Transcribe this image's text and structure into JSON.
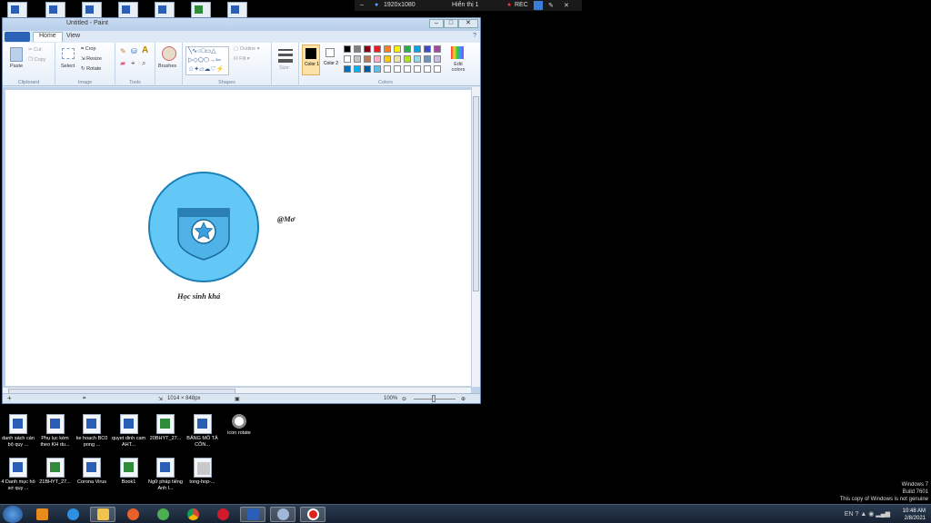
{
  "recorder": {
    "resolution": "1920x1080",
    "display": "Hiển thị 1",
    "rec_label": "REC"
  },
  "window": {
    "title": "Untitled - Paint"
  },
  "ribbon": {
    "tabs": [
      "Home",
      "View"
    ],
    "clipboard": {
      "paste": "Paste",
      "cut": "Cut",
      "copy": "Copy",
      "label": "Clipboard"
    },
    "image": {
      "select": "Select",
      "crop": "Crop",
      "resize": "Resize",
      "rotate": "Rotate",
      "label": "Image"
    },
    "tools": {
      "label": "Tools"
    },
    "brushes": "Brushes",
    "shapes": {
      "outline": "Outline",
      "fill": "Fill",
      "label": "Shapes"
    },
    "size": "Size",
    "color1": "Color 1",
    "color2": "Color 2",
    "edit_colors": "Edit colors",
    "colors_label": "Colors",
    "palette_row1": [
      "#000000",
      "#7f7f7f",
      "#880015",
      "#ed1c24",
      "#ff7f27",
      "#fff200",
      "#22b14c",
      "#00a2e8",
      "#3f48cc",
      "#a349a4"
    ],
    "palette_row2": [
      "#ffffff",
      "#c3c3c3",
      "#b97a57",
      "#ffaec9",
      "#ffc90e",
      "#efe4b0",
      "#b5e61d",
      "#99d9ea",
      "#7092be",
      "#c8bfe7"
    ],
    "palette_row3": [
      "#0070c0",
      "#00b0f0",
      "#005a9e",
      "#5bc0eb",
      "#ffffff",
      "#ffffff",
      "#ffffff",
      "#ffffff",
      "#ffffff",
      "#ffffff"
    ]
  },
  "canvas": {
    "watermark_text": "@Mơ",
    "caption": "Học sinh khá",
    "badge_outer": "#63c8f5",
    "badge_ring": "#1b80b8",
    "shield_fill": "#4fb3e8",
    "shield_band": "#2a7fb4",
    "star_fill": "#3aa0e0"
  },
  "status": {
    "dimensions": "1014 × 848px",
    "zoom": "100%"
  },
  "desktop_icons": [
    {
      "label": "danh sách cán bộ quy ...",
      "kind": "word"
    },
    {
      "label": "Phụ lục kèm theo KH du...",
      "kind": "word"
    },
    {
      "label": "ke hoach BC0 pong ...",
      "kind": "word"
    },
    {
      "label": "quyet dinh cam AHT...",
      "kind": "word"
    },
    {
      "label": "20BHYT_27...",
      "kind": "excel"
    },
    {
      "label": "BẢNG MÔ TẢ CÔN...",
      "kind": "word"
    },
    {
      "label": "icon rotate",
      "kind": "round"
    },
    {
      "label": "4 Danh mục hồ sơ quy ...",
      "kind": "word"
    },
    {
      "label": "21BHYT_27...",
      "kind": "excel"
    },
    {
      "label": "Corona Virus",
      "kind": "word"
    },
    {
      "label": "Book1",
      "kind": "excel"
    },
    {
      "label": "Ngữ pháp tiếng Anh l...",
      "kind": "word"
    },
    {
      "label": "tong-hop-...",
      "kind": "doc"
    }
  ],
  "watermark": {
    "line1": "Windows 7",
    "line2": "Build 7601",
    "line3": "This copy of Windows is not genuine"
  },
  "tray": {
    "lang": "EN",
    "time": "10:48 AM",
    "date": "2/8/2021"
  }
}
